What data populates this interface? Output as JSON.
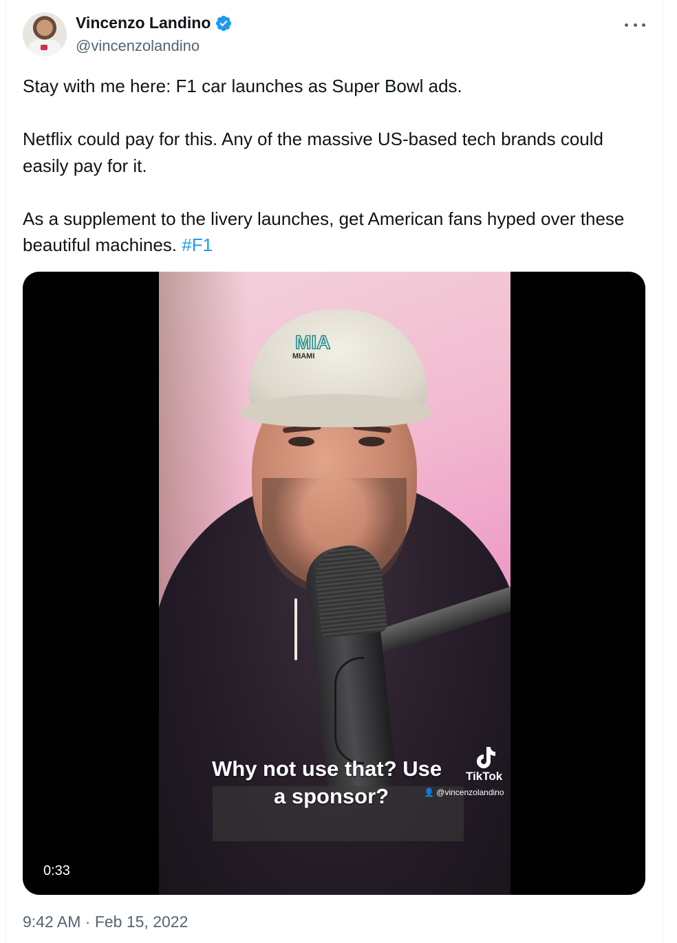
{
  "author": {
    "display_name": "Vincenzo Landino",
    "handle": "@vincenzolandino",
    "verified": true,
    "verified_color": "#1d9bf0"
  },
  "more_menu": {
    "icon": "more-horizontal-icon"
  },
  "tweet": {
    "line1": "Stay with me here: F1 car launches as Super Bowl ads.",
    "line2": "Netflix could pay for this. Any of the massive US-based tech brands could easily pay for it.",
    "line3": "As a supplement to the livery launches, get American fans hyped over these beautiful machines.",
    "hashtag": "#F1",
    "link_color": "#1d9bf0"
  },
  "video": {
    "duration": "0:33",
    "subtitle_line1": "Why not use that? Use",
    "subtitle_line2": "a sponsor?",
    "cap_logo": "MIA",
    "cap_text": "MIAMI",
    "watermark_brand": "TikTok",
    "watermark_user": "@vincenzolandino"
  },
  "meta": {
    "timestamp": "9:42 AM · Feb 15, 2022"
  }
}
